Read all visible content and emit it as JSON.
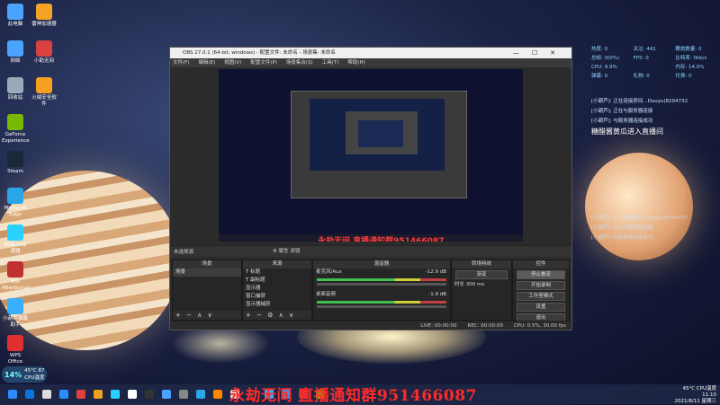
{
  "desktop": {
    "icons_col1": [
      {
        "label": "此电脑",
        "color": "#4aa3ff"
      },
      {
        "label": "网络",
        "color": "#4aa3ff"
      },
      {
        "label": "回收站",
        "color": "#9ab"
      },
      {
        "label": "GeForce Experience",
        "color": "#76b900"
      },
      {
        "label": "Steam",
        "color": "#1b2838"
      },
      {
        "label": "Microsoft Edge",
        "color": "#2aa7e8"
      },
      {
        "label": "网易UU加速器",
        "color": "#2ad0ff"
      },
      {
        "label": "MSI Afterburner",
        "color": "#c03030"
      },
      {
        "label": "小葫芦弹幕助手",
        "color": "#38b0ff"
      },
      {
        "label": "WPS Office",
        "color": "#e03030"
      }
    ],
    "icons_col2": [
      {
        "label": "雷神加速器",
        "color": "#f3a325"
      },
      {
        "label": "小助无间",
        "color": "#d94040"
      },
      {
        "label": "火绒安全软件",
        "color": "#f5a020"
      }
    ]
  },
  "stats": {
    "row1": [
      "热度: 0",
      "关注: 441",
      "鞭炮数量: 0"
    ],
    "row2": [
      "总帧: 0(0%)",
      "FPS: 0",
      "比特率: 0kb/s"
    ],
    "row3": [
      "CPU: 9.9%",
      "",
      "内存: 14.0%"
    ],
    "row4": [
      "弹幕: 0",
      "礼物: 0",
      "付费: 0"
    ]
  },
  "chat": [
    "[小葫芦]: 正在连接房间...Douyu(8204732",
    "[小葫芦]: 正在与服务器连接",
    "[小葫芦]: 与服务器连接成功"
  ],
  "chat_big": "糖醋酱黄瓜进入直播间",
  "chat_faded": [
    "[小葫芦]: 正在连接房间...Douyu(8204732",
    "[小葫芦]: 正在与服务器连接",
    "[小葫芦]: 与服务器连接成功"
  ],
  "obs": {
    "title": "OBS 27.0.1 (64-bit, windows) - 配置文件: 未命名 - 场景集: 未命名",
    "controls": "—☐✕",
    "menu": [
      "文件(F)",
      "编辑(E)",
      "视图(V)",
      "配置文件(P)",
      "场景集合(S)",
      "工具(T)",
      "帮助(H)"
    ],
    "overlay_text": "永劫无间  直播通知群951466087",
    "scene_label": "未选择源",
    "scene_tabs": "⚙ 属性   滤镜",
    "docks": {
      "scenes": {
        "title": "场景",
        "items": [
          "场景"
        ],
        "foot": "+ − ∧ ∨"
      },
      "sources": {
        "title": "来源",
        "items": [
          "T 标题",
          "T 副标题",
          "显示器",
          "窗口捕获",
          "显示器捕获"
        ],
        "foot": "+ − ⚙ ∧ ∨"
      },
      "mixer": {
        "title": "混音器",
        "tracks": [
          {
            "name": "麦克风/Aux",
            "db": "-12.9 dB"
          },
          {
            "name": "桌面音频",
            "db": "-1.9 dB"
          }
        ]
      },
      "transitions": {
        "title": "转场特效",
        "type": "渐变",
        "duration_label": "时长",
        "duration": "300 ms"
      },
      "controls": {
        "title": "控件",
        "buttons": [
          "停止推流",
          "开始录制",
          "工作室模式",
          "设置",
          "退出"
        ]
      }
    },
    "status": [
      "LIVE: 00:00:00",
      "REC: 00:00:00",
      "CPU: 0.5%, 30.00 fps"
    ]
  },
  "watermark": "永劫无间  直播通知群951466087",
  "cpu_widget": {
    "pct": "14%",
    "temp": "45°C 87",
    "label": "CPU温度"
  },
  "tray": {
    "weather": "45°C CPU温度",
    "time": "11:10",
    "date": "2021/8/11 星期三"
  },
  "taskbar_icons": [
    "#0a74da",
    "#ddd",
    "#2a8cff",
    "#e04040",
    "#f0a020",
    "#2ad0ff",
    "#ffffff",
    "#333",
    "#4aa3ff",
    "#888",
    "#2aa7e8",
    "#ff8800",
    "#ddd",
    "#333",
    "#38b0ff",
    "#4a90e2",
    "#c33",
    "#76b900"
  ]
}
